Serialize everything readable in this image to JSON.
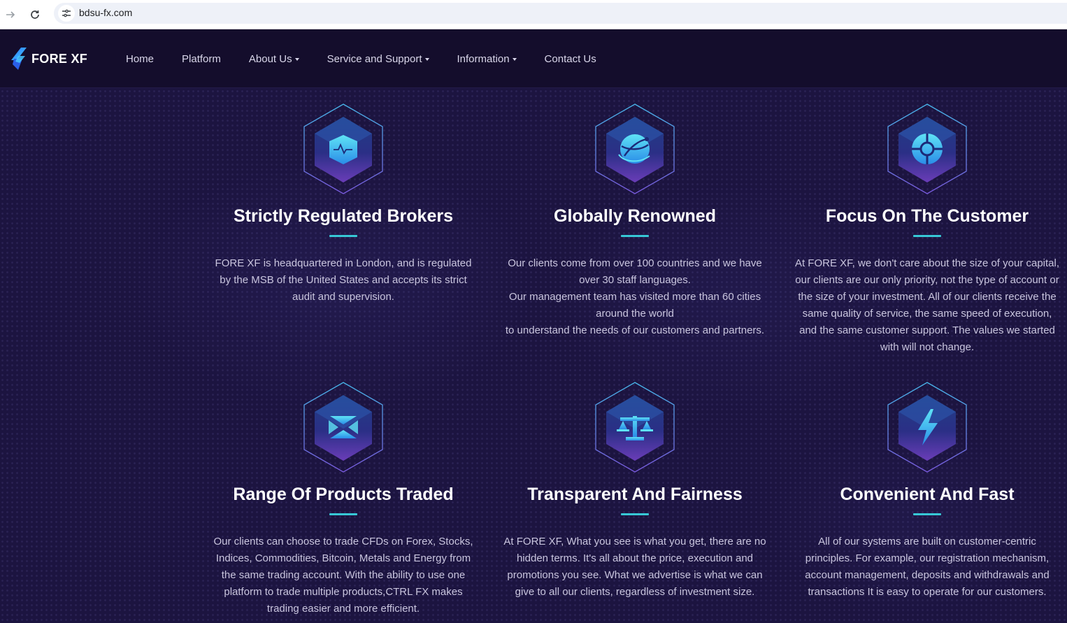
{
  "browser": {
    "url": "bdsu-fx.com",
    "forward_icon": "arrow-right-icon",
    "reload_icon": "reload-icon",
    "site_info_icon": "tune-icon"
  },
  "header": {
    "logo_text": "FORE XF",
    "nav": [
      {
        "label": "Home",
        "dropdown": false
      },
      {
        "label": "Platform",
        "dropdown": false
      },
      {
        "label": "About Us",
        "dropdown": true
      },
      {
        "label": "Service and Support",
        "dropdown": true
      },
      {
        "label": "Information",
        "dropdown": true
      },
      {
        "label": "Contact Us",
        "dropdown": false
      }
    ]
  },
  "colors": {
    "page_bg": "#1c1440",
    "header_bg": "#140d2c",
    "accent": "#37c8d6",
    "hex_border": "#4aa6e8"
  },
  "features": [
    {
      "icon": "pulse-shield-icon",
      "title": "Strictly Regulated Brokers",
      "description": "FORE XF is headquartered in London, and is regulated by the MSB of the United States and accepts its strict audit and supervision."
    },
    {
      "icon": "globe-icon",
      "title": "Globally Renowned",
      "description": "Our clients come from over 100 countries and we have over 30 staff languages.\nOur management team has visited more than 60 cities around the world\nto understand the needs of our customers and partners."
    },
    {
      "icon": "target-icon",
      "title": "Focus On The Customer",
      "description": "At FORE XF, we don't care about the size of your capital, our clients are our only priority, not the type of account or the size of your investment. All of our clients receive the same quality of service, the same speed of execution, and the same customer support. The values we started with will not change."
    },
    {
      "icon": "cube-layers-icon",
      "title": "Range Of Products Traded",
      "description": "Our clients can choose to trade CFDs on Forex, Stocks, Indices, Commodities, Bitcoin, Metals and Energy from the same trading account. With the ability to use one platform to trade multiple products,CTRL FX makes trading easier and more efficient."
    },
    {
      "icon": "scales-icon",
      "title": "Transparent And Fairness",
      "description": "At FORE XF, What you see is what you get, there are no hidden terms. It's all about the price, execution and promotions you see. What we advertise is what we can give to all our clients, regardless of investment size."
    },
    {
      "icon": "lightning-icon",
      "title": "Convenient And Fast",
      "description": "All of our systems are built on customer-centric principles. For example, our registration mechanism, account management, deposits and withdrawals and transactions It is easy to operate for our customers."
    }
  ]
}
